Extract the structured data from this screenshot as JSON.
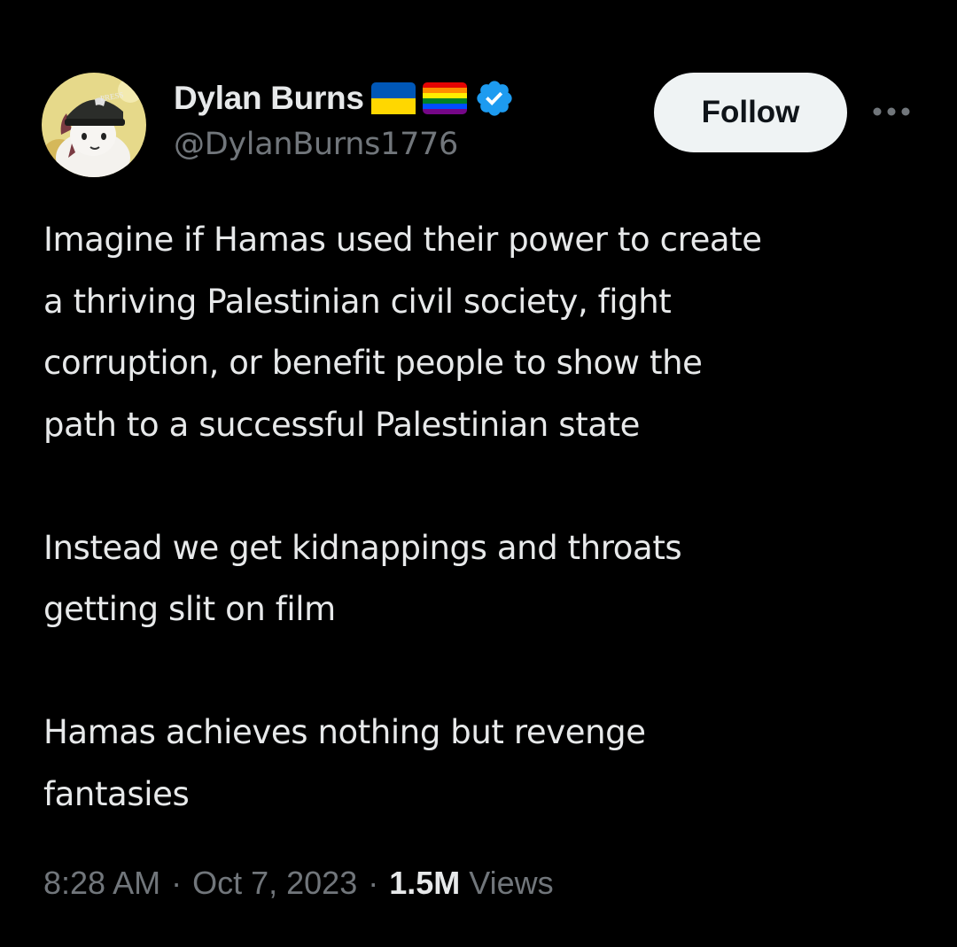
{
  "author": {
    "display_name": "Dylan Burns",
    "handle": "@DylanBurns1776",
    "avatar_text": "PRESS",
    "badges": [
      "ukraine-flag-icon",
      "rainbow-flag-icon",
      "verified-badge-icon"
    ]
  },
  "actions": {
    "follow_label": "Follow",
    "more_icon": "more-horizontal-icon"
  },
  "tweet": {
    "paragraphs": [
      [
        "Imagine if Hamas used their power to create",
        "a thriving Palestinian civil society, fight",
        "corruption, or benefit people to show the",
        "path to a successful Palestinian state"
      ],
      [
        "Instead we get kidnappings and throats",
        "getting slit on film"
      ],
      [
        "Hamas achieves nothing but revenge",
        "fantasies"
      ]
    ]
  },
  "meta": {
    "time": "8:28 AM",
    "separator": "·",
    "date": "Oct 7, 2023",
    "views_count": "1.5M",
    "views_label": "Views"
  },
  "colors": {
    "background": "#000000",
    "primary_text": "#e7e9ea",
    "secondary_text": "#71767b",
    "follow_bg": "#eff3f4",
    "verified": "#1d9bf0",
    "ukraine_blue": "#0057b7",
    "ukraine_yellow": "#ffd700"
  }
}
